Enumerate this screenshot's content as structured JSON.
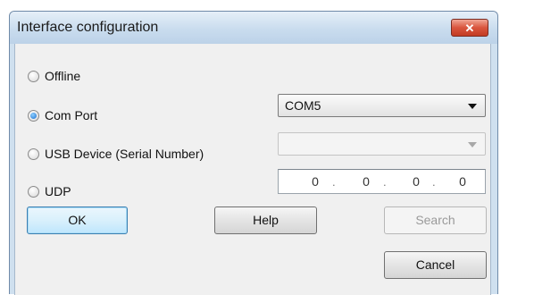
{
  "window": {
    "title": "Interface configuration",
    "close_icon": "close-icon"
  },
  "options": {
    "offline_label": "Offline",
    "com_port_label": "Com Port",
    "usb_label": "USB Device (Serial Number)",
    "udp_label": "UDP",
    "selected": "Com Port"
  },
  "com_port": {
    "value": "COM5"
  },
  "usb_device": {
    "value": ""
  },
  "udp": {
    "ip": [
      "0",
      "0",
      "0",
      "0"
    ]
  },
  "buttons": {
    "ok": "OK",
    "help": "Help",
    "search": "Search",
    "cancel": "Cancel"
  },
  "colors": {
    "title_bar": "#c9dcee",
    "close_button": "#d9553d",
    "default_button_border": "#3c7fb1",
    "dialog_background": "#f0f0f0"
  }
}
